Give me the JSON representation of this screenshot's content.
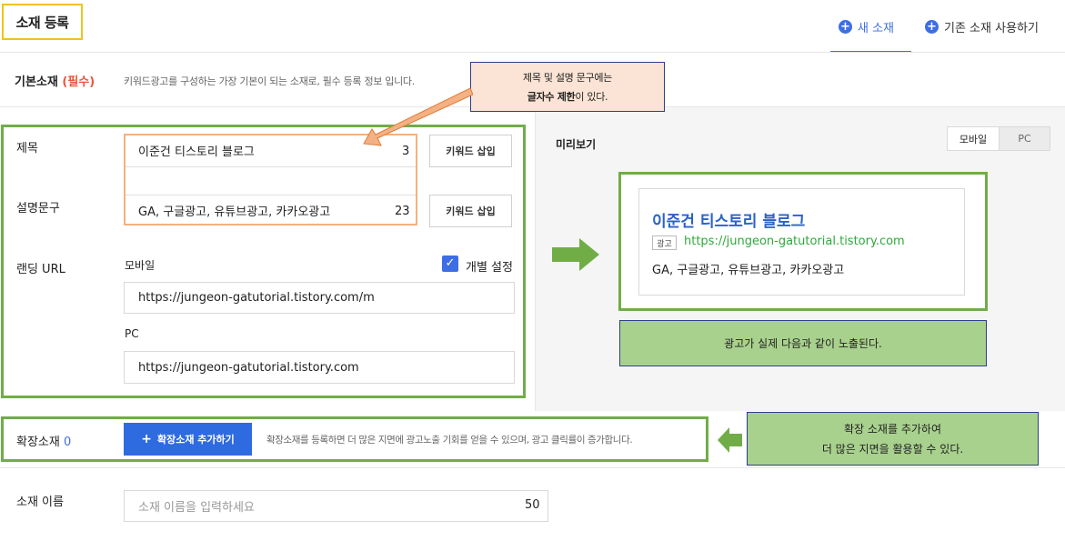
{
  "header": {
    "title": "소재 등록",
    "tab_new": "새 소재",
    "tab_existing": "기존 소재 사용하기"
  },
  "basic": {
    "label": "기본소재",
    "required": "(필수)",
    "description": "키워드광고를 구성하는 가장 기본이 되는 소재로, 필수 등록 정보 입니다."
  },
  "callout_top": {
    "line1": "제목 및 설명 문구에는",
    "line2_bold": "글자수 제한",
    "line2_rest": "이 있다."
  },
  "form": {
    "title_label": "제목",
    "title_value": "이준건 티스토리 블로그",
    "title_count": "3",
    "desc_label": "설명문구",
    "desc_value": "GA, 구글광고, 유튜브광고, 카카오광고",
    "desc_count": "23",
    "keyword_btn": "키워드 삽입",
    "landing_label": "랜딩 URL",
    "mobile_label": "모바일",
    "individual_label": "개별 설정",
    "mobile_url": "https://jungeon-gatutorial.tistory.com/m",
    "pc_label": "PC",
    "pc_url": "https://jungeon-gatutorial.tistory.com"
  },
  "preview": {
    "label": "미리보기",
    "seg_mobile": "모바일",
    "seg_pc": "PC",
    "ad_title": "이준건 티스토리 블로그",
    "ad_badge": "광고",
    "ad_url": "https://jungeon-gatutorial.tistory.com",
    "ad_desc": "GA, 구글광고, 유튜브광고, 카카오광고",
    "note": "광고가 실제 다음과 같이 노출된다."
  },
  "extension": {
    "label": "확장소재",
    "count": "0",
    "add_btn": "확장소재 추가하기",
    "description": "확장소재를 등록하면 더 많은 지면에 광고노출 기회를 얻을 수 있으며, 광고 클릭률이 증가합니다.",
    "note_line1": "확장 소재를 추가하여",
    "note_line2": "더 많은 지면을 활용할 수 있다."
  },
  "name": {
    "label": "소재 이름",
    "placeholder": "소재 이름을 입력하세요",
    "count": "50"
  },
  "colors": {
    "accent": "#3e6ee5",
    "annotation_green": "#70ad47",
    "annotation_orange": "#f4b183",
    "title_highlight": "#f2c21b"
  }
}
